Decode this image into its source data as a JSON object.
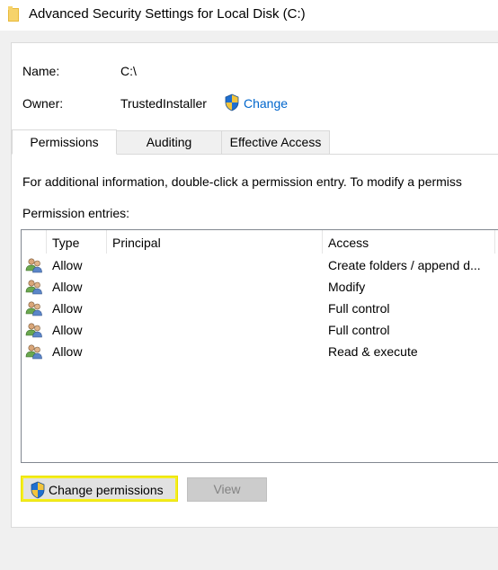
{
  "window": {
    "title": "Advanced Security Settings for Local Disk (C:)",
    "title_icon": "folder-icon"
  },
  "name_row": {
    "label": "Name:",
    "value": "C:\\"
  },
  "owner_row": {
    "label": "Owner:",
    "value": "TrustedInstaller",
    "change_link": "Change",
    "icon": "uac-shield-icon"
  },
  "tabs": [
    {
      "label": "Permissions",
      "active": true
    },
    {
      "label": "Auditing",
      "active": false
    },
    {
      "label": "Effective Access",
      "active": false
    }
  ],
  "info_text": "For additional information, double-click a permission entry. To modify a permiss",
  "entries_label": "Permission entries:",
  "table": {
    "columns": [
      "Type",
      "Principal",
      "Access"
    ],
    "rows": [
      {
        "icon": "users-icon",
        "type": "Allow",
        "principal": "",
        "access": "Create folders / append d..."
      },
      {
        "icon": "users-icon",
        "type": "Allow",
        "principal": "",
        "access": "Modify"
      },
      {
        "icon": "users-icon",
        "type": "Allow",
        "principal": "",
        "access": "Full control"
      },
      {
        "icon": "users-icon",
        "type": "Allow",
        "principal": "",
        "access": "Full control"
      },
      {
        "icon": "users-icon",
        "type": "Allow",
        "principal": "",
        "access": "Read & execute"
      }
    ]
  },
  "buttons": {
    "change_permissions": "Change permissions",
    "view": "View"
  },
  "colors": {
    "link": "#0066cc",
    "highlight": "#f5ee1e",
    "disabled_text": "#838383"
  }
}
